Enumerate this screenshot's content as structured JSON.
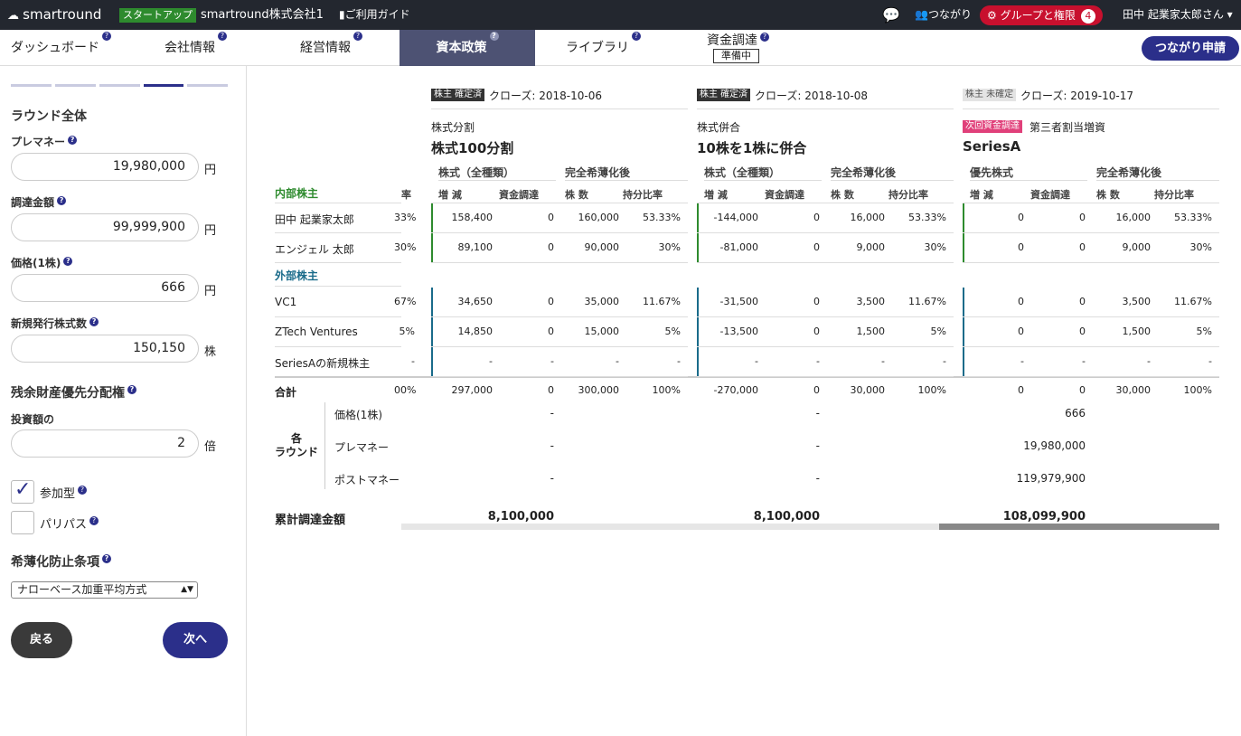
{
  "topbar": {
    "logo": "smartround",
    "stage": "スタートアップ",
    "company": "smartround株式会社1",
    "guide": "ご利用ガイド",
    "connections": "つながり",
    "groups": "グループと権限",
    "groups_count": "4",
    "user": "田中 起業家太郎さん"
  },
  "nav": {
    "items": [
      "ダッシュボード",
      "会社情報",
      "経営情報",
      "資本政策",
      "ライブラリ"
    ],
    "funding": "資金調達",
    "funding_status": "準備中",
    "request_button": "つながり申請"
  },
  "sidebar": {
    "section_round": "ラウンド全体",
    "premoney_label": "プレマネー",
    "premoney_value": "19,980,000",
    "unit_yen": "円",
    "raise_label": "調達金額",
    "raise_value": "99,999,900",
    "price_label": "価格(1株)",
    "price_value": "666",
    "shares_label": "新規発行株式数",
    "shares_value": "150,150",
    "unit_shares": "株",
    "liq_label": "残余財産優先分配権",
    "invest_label": "投資額の",
    "invest_value": "2",
    "unit_times": "倍",
    "participating": "参加型",
    "paripassu": "パリパス",
    "anti_label": "希薄化防止条項",
    "anti_value": "ナローベース加重平均方式",
    "back_button": "戻る",
    "next_button": "次へ"
  },
  "table": {
    "internal_label": "内部株主",
    "external_label": "外部株主",
    "total_label": "合計",
    "each_round": "各\nラウンド",
    "round_rows": [
      "価格(1株)",
      "プレマネー",
      "ポストマネー"
    ],
    "cum_label": "累計調達金額",
    "cut_header": "率",
    "shareholders_int": [
      "田中 起業家太郎",
      "エンジェル 太郎"
    ],
    "shareholders_ext": [
      "VC1",
      "ZTech Ventures",
      "SeriesAの新規株主"
    ],
    "cut_col": [
      "33%",
      "30%",
      "67%",
      "5%",
      "-",
      "00%"
    ],
    "rounds": [
      {
        "status": "株主 確定済",
        "close": "クローズ: 2018-10-06",
        "type": "株式分割",
        "name": "株式100分割",
        "g1": "株式（全種類）",
        "g2": "完全希薄化後",
        "c1": "増 減",
        "c2": "資金調達",
        "c3": "株 数",
        "c4": "持分比率",
        "rows": [
          [
            "158,400",
            "0",
            "160,000",
            "53.33%"
          ],
          [
            "89,100",
            "0",
            "90,000",
            "30%"
          ],
          [
            "34,650",
            "0",
            "35,000",
            "11.67%"
          ],
          [
            "14,850",
            "0",
            "15,000",
            "5%"
          ],
          [
            "-",
            "-",
            "-",
            "-"
          ]
        ],
        "total": [
          "297,000",
          "0",
          "300,000",
          "100%"
        ],
        "price": "-",
        "pre": "-",
        "post": "-",
        "cum": "8,100,000"
      },
      {
        "status": "株主 確定済",
        "close": "クローズ: 2018-10-08",
        "type": "株式併合",
        "name": "10株を1株に併合",
        "g1": "株式（全種類）",
        "g2": "完全希薄化後",
        "c1": "増 減",
        "c2": "資金調達",
        "c3": "株 数",
        "c4": "持分比率",
        "rows": [
          [
            "-144,000",
            "0",
            "16,000",
            "53.33%"
          ],
          [
            "-81,000",
            "0",
            "9,000",
            "30%"
          ],
          [
            "-31,500",
            "0",
            "3,500",
            "11.67%"
          ],
          [
            "-13,500",
            "0",
            "1,500",
            "5%"
          ],
          [
            "-",
            "-",
            "-",
            "-"
          ]
        ],
        "total": [
          "-270,000",
          "0",
          "30,000",
          "100%"
        ],
        "price": "-",
        "pre": "-",
        "post": "-",
        "cum": "8,100,000"
      },
      {
        "status": "株主 未確定",
        "close": "クローズ: 2019-10-17",
        "next_tag": "次回資金調達",
        "type": "第三者割当増資",
        "name": "SeriesA",
        "g1": "優先株式",
        "g2": "完全希薄化後",
        "c1": "増 減",
        "c2": "資金調達",
        "c3": "株 数",
        "c4": "持分比率",
        "rows": [
          [
            "0",
            "0",
            "16,000",
            "53.33%"
          ],
          [
            "0",
            "0",
            "9,000",
            "30%"
          ],
          [
            "0",
            "0",
            "3,500",
            "11.67%"
          ],
          [
            "0",
            "0",
            "1,500",
            "5%"
          ],
          [
            "-",
            "-",
            "-",
            "-"
          ]
        ],
        "total": [
          "0",
          "0",
          "30,000",
          "100%"
        ],
        "price": "666",
        "pre": "19,980,000",
        "post": "119,979,900",
        "cum": "108,099,900"
      }
    ]
  },
  "colors": {
    "topbar": "#23272f",
    "accent": "#2b2f8a",
    "active_tab": "#4d5273",
    "internal": "#2e8b2e",
    "external": "#1a6b8a",
    "alert": "#c8102e"
  }
}
